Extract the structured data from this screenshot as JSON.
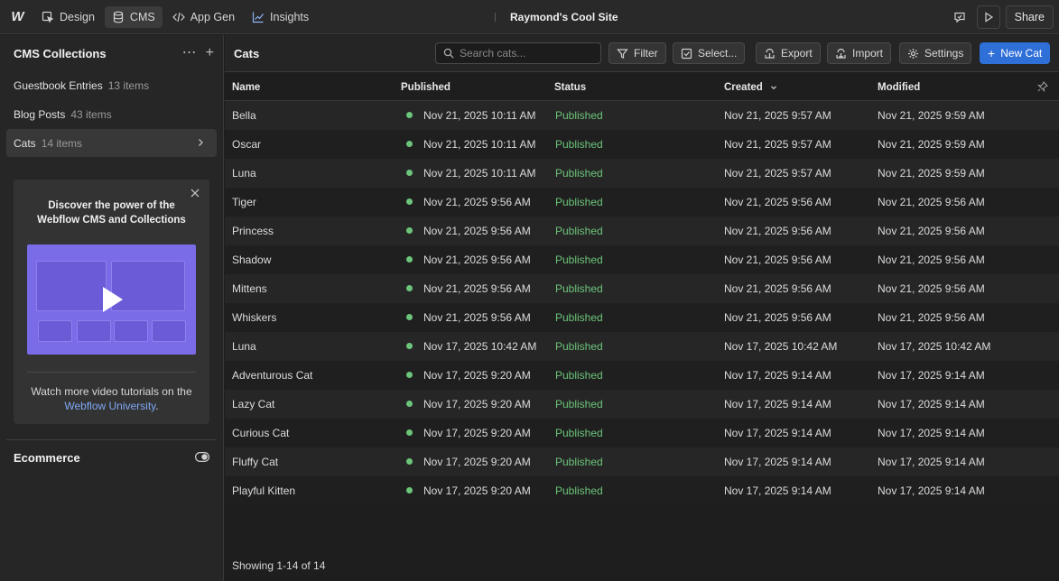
{
  "colors": {
    "accent": "#2f6fd8",
    "published_dot": "#6cc57a",
    "promo_video_bg": "#7a6be6",
    "link": "#7fa8f5"
  },
  "topbar": {
    "logo_icon": "webflow-logo",
    "nav": [
      {
        "label": "Design",
        "icon": "cursor-box-icon"
      },
      {
        "label": "CMS",
        "icon": "database-icon"
      },
      {
        "label": "App Gen",
        "icon": "code-icon"
      },
      {
        "label": "Insights",
        "icon": "chart-line-icon"
      }
    ],
    "site_title": "Raymond's Cool Site",
    "share_label": "Share"
  },
  "sidebar": {
    "title": "CMS Collections",
    "collections": [
      {
        "name": "Guestbook Entries",
        "count": "13 items"
      },
      {
        "name": "Blog Posts",
        "count": "43 items"
      },
      {
        "name": "Cats",
        "count": "14 items"
      }
    ],
    "promo": {
      "title_line1": "Discover the power of the",
      "title_line2": "Webflow CMS and Collections",
      "text": "Watch more video tutorials on the",
      "link": "Webflow University",
      "link_suffix": "."
    },
    "ecommerce_label": "Ecommerce"
  },
  "main": {
    "title": "Cats",
    "search_placeholder": "Search cats...",
    "buttons": {
      "filter": "Filter",
      "select": "Select...",
      "export": "Export",
      "import": "Import",
      "settings": "Settings",
      "new": "New Cat"
    },
    "columns": {
      "name": "Name",
      "published": "Published",
      "status": "Status",
      "created": "Created",
      "modified": "Modified"
    },
    "rows": [
      {
        "name": "Bella",
        "published": "Nov 21, 2025 10:11 AM",
        "status": "Published",
        "created": "Nov 21, 2025 9:57 AM",
        "modified": "Nov 21, 2025 9:59 AM"
      },
      {
        "name": "Oscar",
        "published": "Nov 21, 2025 10:11 AM",
        "status": "Published",
        "created": "Nov 21, 2025 9:57 AM",
        "modified": "Nov 21, 2025 9:59 AM"
      },
      {
        "name": "Luna",
        "published": "Nov 21, 2025 10:11 AM",
        "status": "Published",
        "created": "Nov 21, 2025 9:57 AM",
        "modified": "Nov 21, 2025 9:59 AM"
      },
      {
        "name": "Tiger",
        "published": "Nov 21, 2025 9:56 AM",
        "status": "Published",
        "created": "Nov 21, 2025 9:56 AM",
        "modified": "Nov 21, 2025 9:56 AM"
      },
      {
        "name": "Princess",
        "published": "Nov 21, 2025 9:56 AM",
        "status": "Published",
        "created": "Nov 21, 2025 9:56 AM",
        "modified": "Nov 21, 2025 9:56 AM"
      },
      {
        "name": "Shadow",
        "published": "Nov 21, 2025 9:56 AM",
        "status": "Published",
        "created": "Nov 21, 2025 9:56 AM",
        "modified": "Nov 21, 2025 9:56 AM"
      },
      {
        "name": "Mittens",
        "published": "Nov 21, 2025 9:56 AM",
        "status": "Published",
        "created": "Nov 21, 2025 9:56 AM",
        "modified": "Nov 21, 2025 9:56 AM"
      },
      {
        "name": "Whiskers",
        "published": "Nov 21, 2025 9:56 AM",
        "status": "Published",
        "created": "Nov 21, 2025 9:56 AM",
        "modified": "Nov 21, 2025 9:56 AM"
      },
      {
        "name": "Luna",
        "published": "Nov 17, 2025 10:42 AM",
        "status": "Published",
        "created": "Nov 17, 2025 10:42 AM",
        "modified": "Nov 17, 2025 10:42 AM"
      },
      {
        "name": "Adventurous Cat",
        "published": "Nov 17, 2025 9:20 AM",
        "status": "Published",
        "created": "Nov 17, 2025 9:14 AM",
        "modified": "Nov 17, 2025 9:14 AM"
      },
      {
        "name": "Lazy Cat",
        "published": "Nov 17, 2025 9:20 AM",
        "status": "Published",
        "created": "Nov 17, 2025 9:14 AM",
        "modified": "Nov 17, 2025 9:14 AM"
      },
      {
        "name": "Curious Cat",
        "published": "Nov 17, 2025 9:20 AM",
        "status": "Published",
        "created": "Nov 17, 2025 9:14 AM",
        "modified": "Nov 17, 2025 9:14 AM"
      },
      {
        "name": "Fluffy Cat",
        "published": "Nov 17, 2025 9:20 AM",
        "status": "Published",
        "created": "Nov 17, 2025 9:14 AM",
        "modified": "Nov 17, 2025 9:14 AM"
      },
      {
        "name": "Playful Kitten",
        "published": "Nov 17, 2025 9:20 AM",
        "status": "Published",
        "created": "Nov 17, 2025 9:14 AM",
        "modified": "Nov 17, 2025 9:14 AM"
      }
    ],
    "footer": "Showing 1-14 of 14"
  }
}
